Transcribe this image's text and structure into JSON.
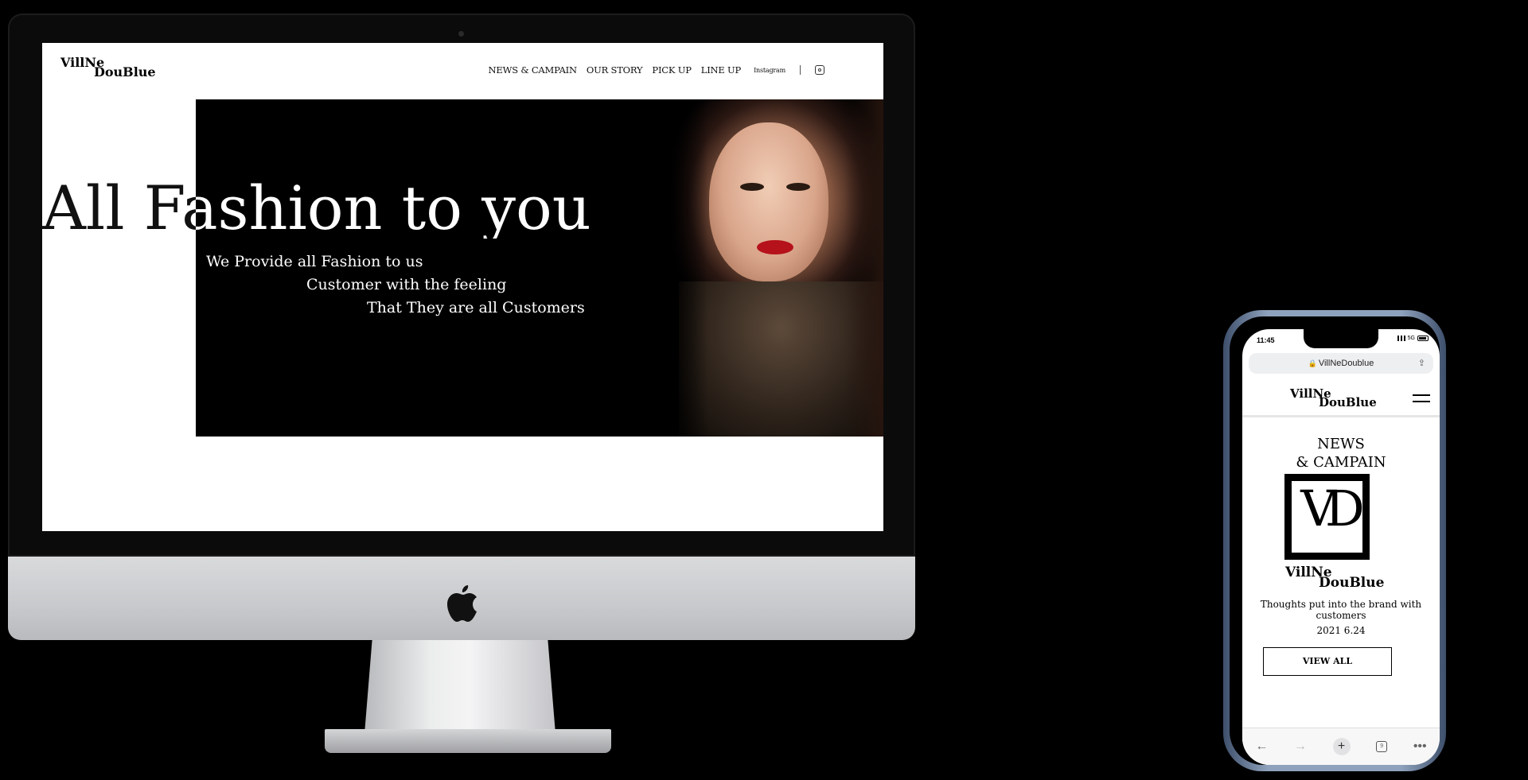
{
  "desktop": {
    "logo": {
      "line1": "VillNe",
      "line2": "DouBlue"
    },
    "nav": [
      {
        "label": "NEWS & CAMPAIN"
      },
      {
        "label": "OUR STORY"
      },
      {
        "label": "PICK UP"
      },
      {
        "label": "LINE UP"
      }
    ],
    "instagram_label": "Instagram",
    "hero": {
      "title": "All Fashion to you",
      "lines": [
        "We Provide all Fashion to us",
        "Customer with the feeling",
        "That They are all Customers"
      ]
    }
  },
  "mobile": {
    "status_time": "11:45",
    "status_network": "5G",
    "url": "VillNeDoublue",
    "logo": {
      "line1": "VillNe",
      "line2": "DouBlue"
    },
    "section_title": {
      "line1": "NEWS",
      "line2": "& CAMPAIN"
    },
    "emblem_text": "VD",
    "brand_logo": {
      "line1": "VillNe",
      "line2": "DouBlue"
    },
    "description": "Thoughts put into the brand with customers",
    "date": "2021 6.24",
    "view_all_label": "VIEW ALL",
    "toolbar": {
      "back": "←",
      "forward": "→",
      "new_tab": "+",
      "tabs_count": "9",
      "more": "•••"
    }
  },
  "colors": {
    "lipstick": "#b5121b",
    "phone_frame": "#8fa2bd"
  }
}
